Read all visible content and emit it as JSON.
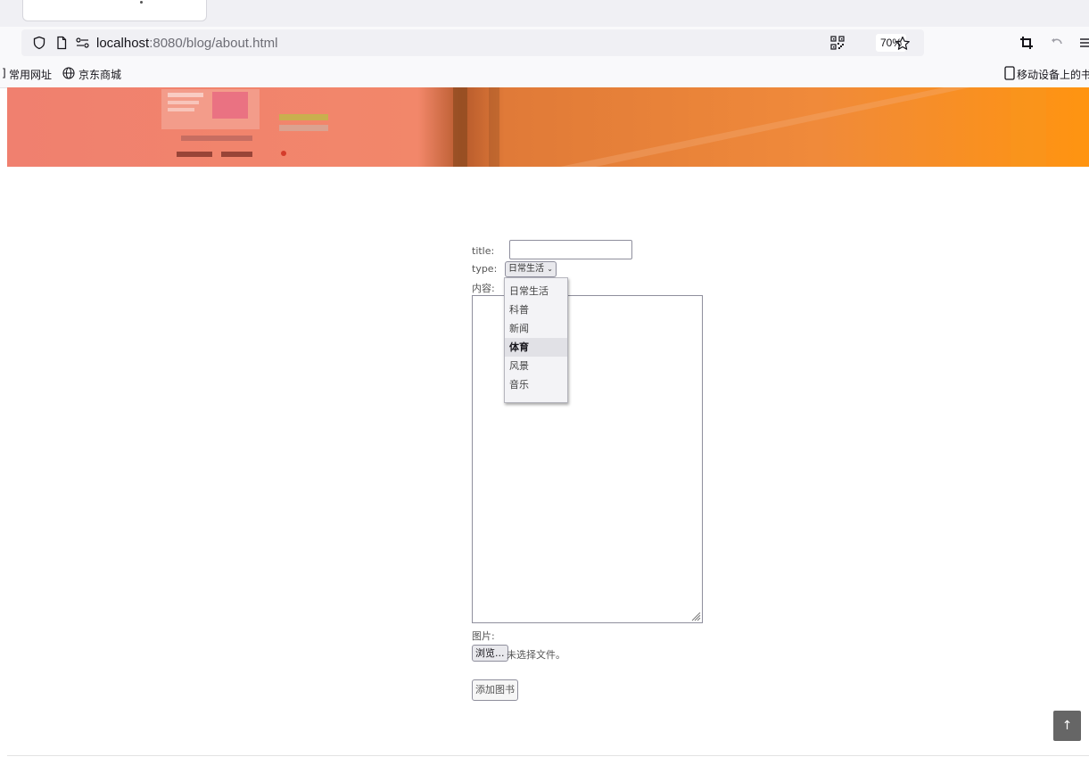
{
  "browser": {
    "url_host": "localhost",
    "url_rest": ":8080/blog/about.html",
    "zoom": "70%",
    "bookmarks": [
      {
        "label": "常用网址"
      },
      {
        "label": "京东商城"
      }
    ],
    "bookmarks_right": "移动设备上的书签",
    "bookmark_left_glyph": "]"
  },
  "form": {
    "title_label": "title:",
    "type_label": "type:",
    "type_selected": "日常生活",
    "content_label": "内容:",
    "image_label": "图片:",
    "browse_label": "浏览...",
    "no_file_text": "未选择文件。",
    "submit_label": "添加图书"
  },
  "dropdown": {
    "options": [
      "日常生活",
      "科普",
      "新闻",
      "体育",
      "风景",
      "音乐"
    ],
    "hovered": "体育"
  },
  "back_to_top": "↑",
  "colors": {
    "banner_start": "#f08470",
    "banner_end": "#ff9410",
    "back_to_top_bg": "#666666"
  }
}
